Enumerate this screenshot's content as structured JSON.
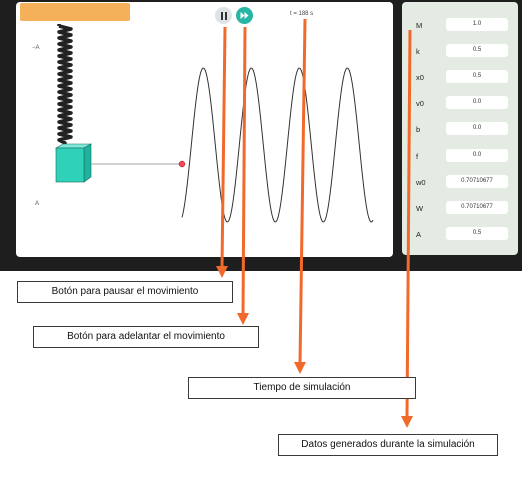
{
  "simulation": {
    "time_label": "t = 188 s",
    "amplitude_top": "−A",
    "amplitude_bottom": "A"
  },
  "parameters": [
    {
      "label": "M",
      "value": "1.0"
    },
    {
      "label": "k",
      "value": "0.5"
    },
    {
      "label": "x0",
      "value": "0.5"
    },
    {
      "label": "v0",
      "value": "0.0"
    },
    {
      "label": "b",
      "value": "0.0"
    },
    {
      "label": "f",
      "value": "0.0"
    },
    {
      "label": "w0",
      "value": "0.70710677"
    },
    {
      "label": "W",
      "value": "0.70710677"
    },
    {
      "label": "A",
      "value": "0.5"
    }
  ],
  "callouts": {
    "pause": "Botón para pausar el movimiento",
    "forward": "Botón para adelantar el movimiento",
    "time": "Tiempo de simulación",
    "data": "Datos generados durante la simulación"
  },
  "colors": {
    "spring_block": "#2fd1b8",
    "arrow": "#f26a2b",
    "forward_button": "#27b5a4",
    "mass_dot": "#e84a5f"
  },
  "icons": [
    "pause-icon",
    "fast-forward-icon"
  ]
}
